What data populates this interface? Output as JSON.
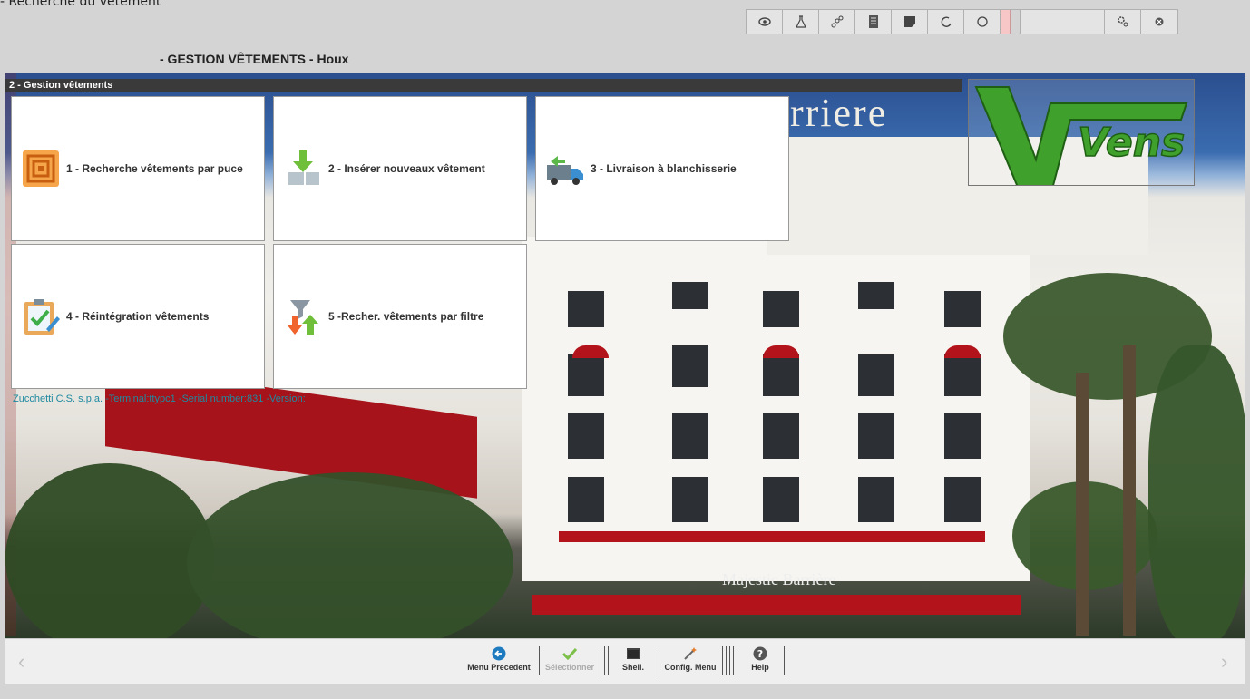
{
  "window": {
    "corner_label": "- Recherche du vêtement"
  },
  "app": {
    "title": "- GESTION VÊTEMENTS - Houx"
  },
  "section": {
    "title": "2 - Gestion vêtements"
  },
  "toolbar": {
    "icons": [
      "eye-icon",
      "flask-icon",
      "share-icon",
      "list-icon",
      "note-icon",
      "undo-icon",
      "refresh-icon",
      "gear-icon",
      "close-icon"
    ]
  },
  "tiles": [
    {
      "label": "1 - Recherche vêtements par puce",
      "icon": "rfid-chip-icon"
    },
    {
      "label": "2 - Insérer nouveaux vêtement",
      "icon": "insert-arrow-icon"
    },
    {
      "label": "3 - Livraison à blanchisserie",
      "icon": "delivery-truck-icon"
    },
    {
      "label": "4 - Réintégration vêtements",
      "icon": "clipboard-check-icon"
    },
    {
      "label": "5 -Recher. vêtements par filtre",
      "icon": "filter-icon"
    }
  ],
  "status": {
    "text": "Zucchetti C.S. s.p.a. -Terminal:ttypc1 -Serial number:831 -Version:"
  },
  "background": {
    "sign_top": "rriere",
    "sign_bottom": "Majestic Barrière"
  },
  "logo": {
    "text": "Vens",
    "color": "#3fa12b"
  },
  "bottom_bar": {
    "buttons": [
      {
        "label": "Menu Precedent",
        "icon": "back-arrow-icon",
        "enabled": true
      },
      {
        "label": "Sélectionner",
        "icon": "checkmark-icon",
        "enabled": false
      },
      {
        "label": "Shell.",
        "icon": "terminal-icon",
        "enabled": true
      },
      {
        "label": "Config. Menu",
        "icon": "wand-icon",
        "enabled": true
      },
      {
        "label": "Help",
        "icon": "help-icon",
        "enabled": true
      }
    ]
  },
  "colors": {
    "accent_blue": "#1e7bbf",
    "check_green": "#7cc04a",
    "section_bar": "#3a3a3a"
  }
}
